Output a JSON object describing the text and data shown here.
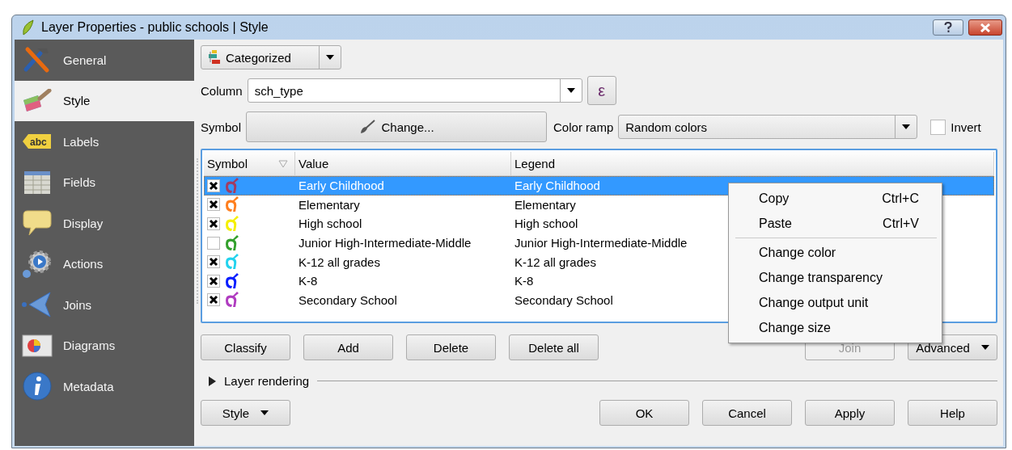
{
  "window": {
    "title": "Layer Properties - public schools | Style"
  },
  "sidebar": {
    "items": [
      {
        "label": "General",
        "selected": false
      },
      {
        "label": "Style",
        "selected": true
      },
      {
        "label": "Labels",
        "selected": false,
        "icon_text": "abc"
      },
      {
        "label": "Fields",
        "selected": false
      },
      {
        "label": "Display",
        "selected": false
      },
      {
        "label": "Actions",
        "selected": false
      },
      {
        "label": "Joins",
        "selected": false
      },
      {
        "label": "Diagrams",
        "selected": false
      },
      {
        "label": "Metadata",
        "selected": false
      }
    ]
  },
  "renderer": {
    "value": "Categorized"
  },
  "column": {
    "label": "Column",
    "value": "sch_type",
    "expression_button": "ε"
  },
  "symbol": {
    "label": "Symbol",
    "button": "Change..."
  },
  "color_ramp": {
    "label": "Color ramp",
    "value": "Random colors"
  },
  "invert": {
    "label": "Invert",
    "checked": false
  },
  "table": {
    "columns": [
      "Symbol",
      "Value",
      "Legend"
    ],
    "rows": [
      {
        "checked": true,
        "color": "#a23c63",
        "value": "Early Childhood",
        "legend": "Early Childhood",
        "selected": true
      },
      {
        "checked": true,
        "color": "#ff7f1e",
        "value": "Elementary",
        "legend": "Elementary",
        "selected": false
      },
      {
        "checked": true,
        "color": "#f5f000",
        "value": "High school",
        "legend": "High school",
        "selected": false
      },
      {
        "checked": false,
        "color": "#33a02c",
        "value": "Junior High-Intermediate-Middle",
        "legend": "Junior High-Intermediate-Middle",
        "selected": false
      },
      {
        "checked": true,
        "color": "#22d3ee",
        "value": "K-12 all grades",
        "legend": "K-12 all grades",
        "selected": false
      },
      {
        "checked": true,
        "color": "#0a1eff",
        "value": "K-8",
        "legend": "K-8",
        "selected": false
      },
      {
        "checked": true,
        "color": "#b03cc0",
        "value": "Secondary School",
        "legend": "Secondary School",
        "selected": false
      }
    ]
  },
  "actions": [
    {
      "label": "Classify",
      "kind": "button",
      "disabled": false
    },
    {
      "label": "Add",
      "kind": "button",
      "disabled": false
    },
    {
      "label": "Delete",
      "kind": "button",
      "disabled": false
    },
    {
      "label": "Delete all",
      "kind": "button",
      "disabled": false
    },
    {
      "label": "Join",
      "kind": "button",
      "disabled": true
    },
    {
      "label": "Advanced",
      "kind": "menu",
      "disabled": false
    }
  ],
  "layer_rendering": {
    "label": "Layer rendering",
    "expanded": false
  },
  "footer": [
    {
      "label": "Style",
      "kind": "menu"
    },
    {
      "label": "OK",
      "kind": "button"
    },
    {
      "label": "Cancel",
      "kind": "button"
    },
    {
      "label": "Apply",
      "kind": "button"
    },
    {
      "label": "Help",
      "kind": "button"
    }
  ],
  "context_menu": [
    {
      "kind": "item",
      "label": "Copy",
      "shortcut": "Ctrl+C"
    },
    {
      "kind": "item",
      "label": "Paste",
      "shortcut": "Ctrl+V"
    },
    {
      "kind": "separator"
    },
    {
      "kind": "item",
      "label": "Change color"
    },
    {
      "kind": "item",
      "label": "Change transparency"
    },
    {
      "kind": "item",
      "label": "Change output unit"
    },
    {
      "kind": "item",
      "label": "Change size"
    }
  ]
}
